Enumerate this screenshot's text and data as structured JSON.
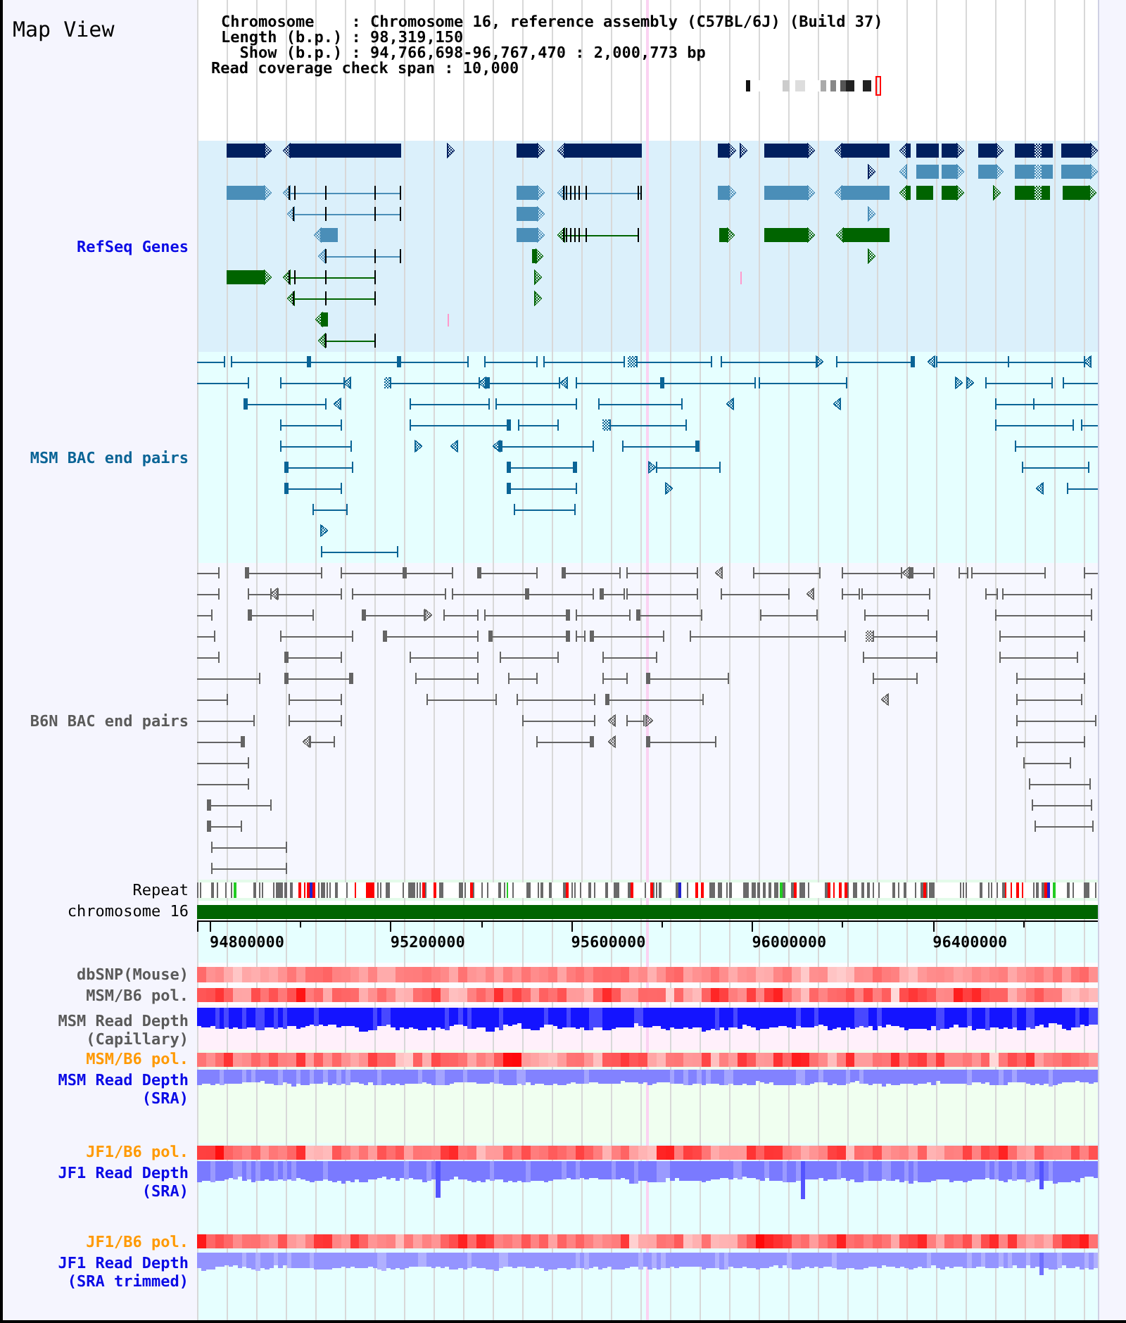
{
  "title": "Map View",
  "info": {
    "separator": ":",
    "lines": [
      {
        "label": "Chromosome",
        "value": "Chromosome 16, reference assembly (C57BL/6J) (Build 37)"
      },
      {
        "label": "Length (b.p.)",
        "value": "98,319,150"
      },
      {
        "label": "Show (b.p.)",
        "value": "94,766,698-96,767,470 : 2,000,773 bp"
      },
      {
        "label": "Read coverage check span",
        "value": "10,000"
      }
    ]
  },
  "tracks": [
    {
      "kind": "genes",
      "label": "RefSeq Genes",
      "color": "#0a0ae6"
    },
    {
      "kind": "bac_pairs",
      "label": "MSM BAC end pairs",
      "color": "#0a6496"
    },
    {
      "kind": "bac_pairs",
      "label": "B6N BAC end pairs",
      "color": "#5a5a5a"
    },
    {
      "kind": "repeat",
      "label": "Repeat",
      "color": "#000000"
    },
    {
      "kind": "chromosome",
      "label": "chromosome 16",
      "color": "#000000"
    },
    {
      "kind": "axis",
      "ticks": [
        "94800000",
        "95200000",
        "95600000",
        "96000000",
        "96400000"
      ]
    },
    {
      "kind": "heatmap",
      "label": "dbSNP(Mouse)",
      "color": "#5a5a5a"
    },
    {
      "kind": "heatmap",
      "label": "MSM/B6 pol.",
      "color": "#5a5a5a"
    },
    {
      "kind": "depth",
      "label": "MSM Read Depth (Capillary)",
      "color": "#5a5a5a"
    },
    {
      "kind": "heatmap",
      "label": "MSM/B6 pol.",
      "color": "#ff9900"
    },
    {
      "kind": "depth",
      "label": "MSM Read Depth (SRA)",
      "color": "#0a0ae6"
    },
    {
      "kind": "heatmap",
      "label": "JF1/B6 pol.",
      "color": "#ff9900"
    },
    {
      "kind": "depth",
      "label": "JF1 Read Depth (SRA)",
      "color": "#0a0ae6"
    },
    {
      "kind": "heatmap",
      "label": "JF1/B6 pol.",
      "color": "#ff9900"
    },
    {
      "kind": "depth",
      "label": "JF1 Read Depth (SRA trimmed)",
      "color": "#0a0ae6"
    }
  ]
}
